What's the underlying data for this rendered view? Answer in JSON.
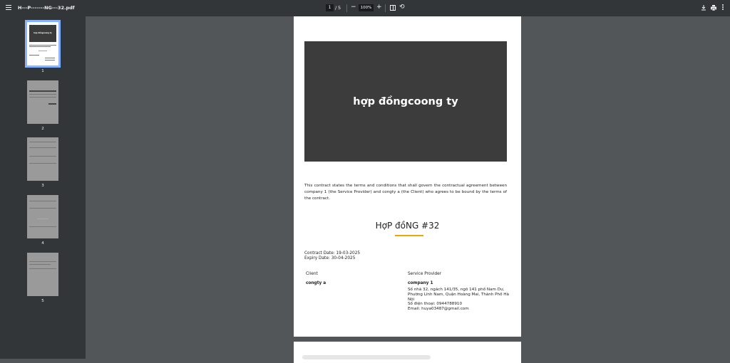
{
  "toolbar": {
    "file_name": "H---P-------NG---32.pdf",
    "current_page": "1",
    "page_separator": "/",
    "total_pages": "5",
    "zoom_minus": "−",
    "zoom_level": "100%",
    "zoom_plus": "+"
  },
  "sidebar": {
    "thumbnails": [
      {
        "label": "1",
        "title_text": "hợp đồngcoong ty"
      },
      {
        "label": "2"
      },
      {
        "label": "3"
      },
      {
        "label": "4"
      },
      {
        "label": "5"
      }
    ]
  },
  "document": {
    "hero_title": "hợp đồngcoong ty",
    "intro": "This contract states the terms and conditions that shall govern the contractual agreement between company 1 (the Service Provider) and congty a (the Client) who agrees to be bound by the terms of the contract.",
    "contract_heading": "HợP đồNG #32",
    "contract_date": "Contract Date: 19-03-2025",
    "expiry_date": "Expiry Date: 30-04-2025",
    "client_label": "Client",
    "client_name": "congty a",
    "provider_label": "Service Provider",
    "provider_name": "company 1",
    "provider_address": "Số nhà 32, ngách 141/35, ngõ 141 phố Nam Dư, Phường Lĩnh Nam, Quận Hoàng Mai, Thành Phố Hà Nội",
    "provider_phone": "Số điện thoại: 0944788910",
    "provider_email": "Email: huya03487@gmail.com"
  },
  "colors": {
    "toolbar_bg": "#323639",
    "viewer_bg": "#525659",
    "hero_bg": "#3d3c3c",
    "accent_rule": "#f0a500",
    "thumb_selected": "#8ab4f8"
  }
}
